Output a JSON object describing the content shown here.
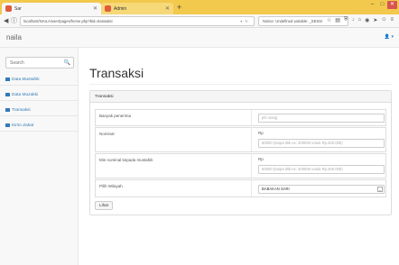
{
  "browser": {
    "tabs": [
      {
        "label": "Sar",
        "favicon_color": "#e15b3b"
      },
      {
        "label": "Admin",
        "favicon_color": "#e15b3b"
      }
    ],
    "new_tab": "+",
    "url": "localhost/NAILA/user/pages/home.php?bid=transaksi",
    "search_text": "Notice: Undefined variable: _SESSI",
    "window_controls": [
      "–",
      "□",
      "✕"
    ],
    "icons": [
      "star-icon",
      "clipboard-icon",
      "shield-icon",
      "download-icon",
      "home-icon",
      "globe-icon",
      "send-icon",
      "smiley-icon",
      "menu-icon"
    ]
  },
  "app": {
    "brand": "naila",
    "user_menu": "👤 ▾"
  },
  "sidebar": {
    "search_placeholder": "Search",
    "items": [
      {
        "label": "Data Mustahik"
      },
      {
        "label": "Data Muzakki"
      },
      {
        "label": "Transaksi"
      },
      {
        "label": "Kirim Zakat"
      }
    ]
  },
  "main": {
    "title": "Transaksi",
    "panel_heading": "Transaksi",
    "rows": [
      {
        "label": "Banyak penerima",
        "placeholder": "jml orang"
      },
      {
        "label": "Nominal",
        "prefix": "Rp",
        "placeholder": "50000 (tanpa titik ex: 200000 untuk Rp.200.000)"
      },
      {
        "label": "Min nominal kepada mustahik",
        "prefix": "Rp",
        "placeholder": "50000 (tanpa titik ex: 200000 untuk Rp.200.000)"
      },
      {
        "label": "Pilih Wilayah",
        "selected": "BABAKAN SARI"
      }
    ],
    "button": "Lihat"
  },
  "colors": {
    "tabbar": "#f2c94c",
    "link": "#337ab7"
  }
}
